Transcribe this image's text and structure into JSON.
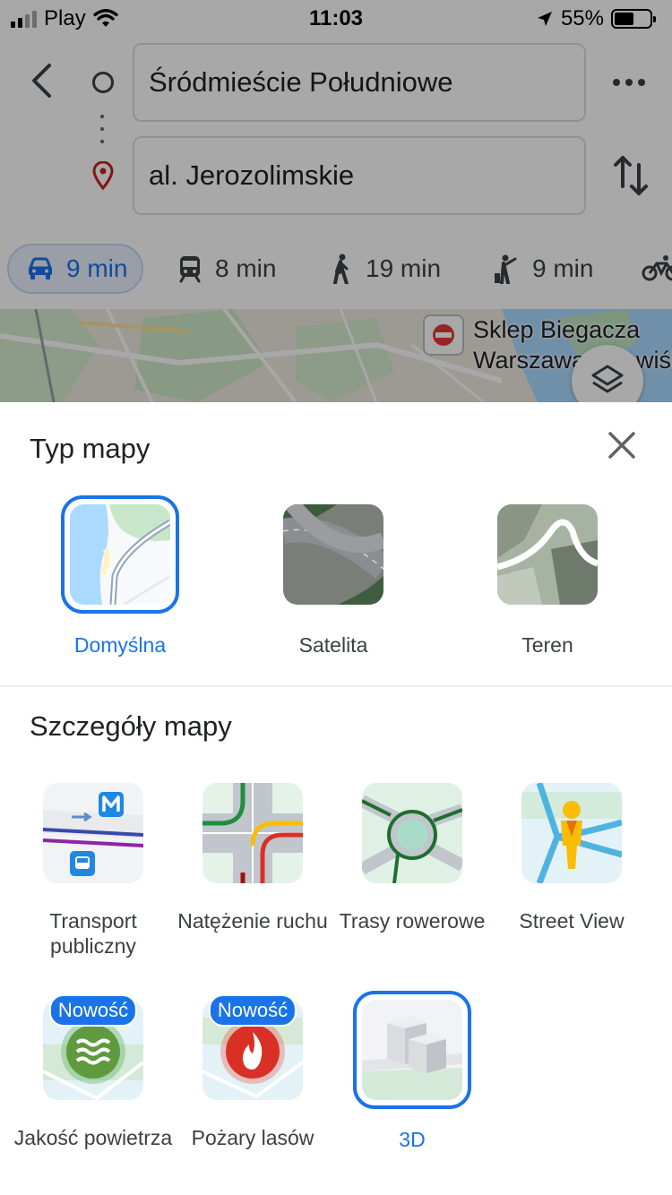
{
  "status_bar": {
    "carrier": "Play",
    "time": "11:03",
    "battery": "55%",
    "battery_level": 0.55
  },
  "route": {
    "origin": "Śródmieście Południowe",
    "destination": "al. Jerozolimskie"
  },
  "travel_modes": [
    {
      "icon": "car-icon",
      "label": "9 min",
      "active": true
    },
    {
      "icon": "train-icon",
      "label": "8 min",
      "active": false
    },
    {
      "icon": "walk-icon",
      "label": "19 min",
      "active": false
    },
    {
      "icon": "ride-hail-icon",
      "label": "9 min",
      "active": false
    },
    {
      "icon": "bicycle-icon",
      "label": "",
      "active": false
    }
  ],
  "map": {
    "poi_line1": "Sklep Biegacza",
    "poi_line2": "Warszawa - Powiśle"
  },
  "sheet": {
    "map_type_title": "Typ mapy",
    "map_types": [
      {
        "label": "Domyślna",
        "selected": true
      },
      {
        "label": "Satelita",
        "selected": false
      },
      {
        "label": "Teren",
        "selected": false
      }
    ],
    "details_title": "Szczegóły mapy",
    "details": [
      {
        "label": "Transport publiczny",
        "icon": "transit-icon",
        "selected": false
      },
      {
        "label": "Natężenie ruchu",
        "icon": "traffic-icon",
        "selected": false
      },
      {
        "label": "Trasy rowerowe",
        "icon": "bike-routes-icon",
        "selected": false
      },
      {
        "label": "Street View",
        "icon": "street-view-icon",
        "selected": false
      },
      {
        "label": "Jakość powietrza",
        "icon": "air-quality-icon",
        "selected": false,
        "badge": "Nowość"
      },
      {
        "label": "Pożary lasów",
        "icon": "wildfire-icon",
        "selected": false,
        "badge": "Nowość"
      },
      {
        "label": "3D",
        "icon": "3d-buildings-icon",
        "selected": true
      }
    ]
  },
  "colors": {
    "accent": "#1a73e8",
    "text": "#3c4043",
    "dim_overlay": "rgba(0,0,0,0.34)"
  }
}
